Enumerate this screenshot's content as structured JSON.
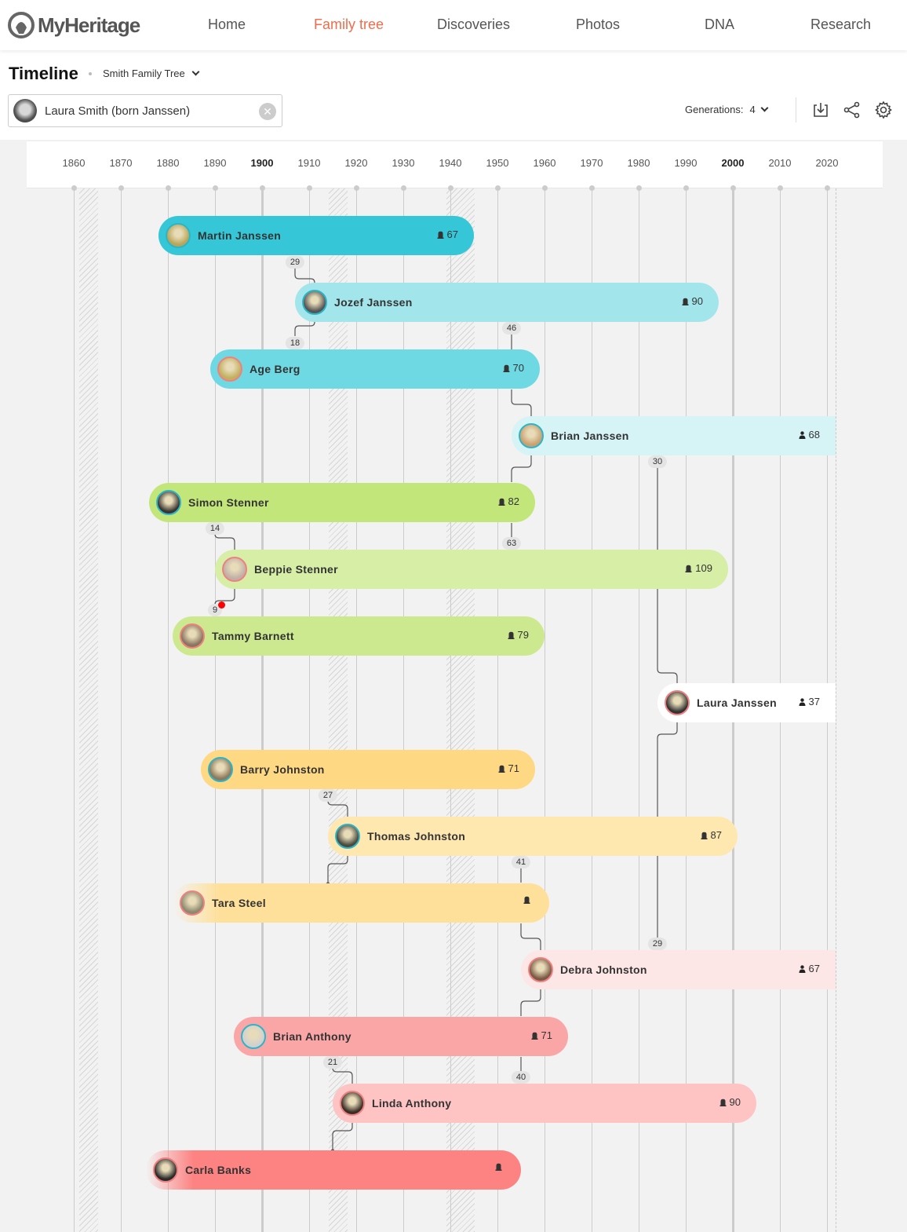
{
  "app": {
    "brand": "MyHeritage",
    "nav": [
      {
        "label": "Home",
        "active": false
      },
      {
        "label": "Family tree",
        "active": true
      },
      {
        "label": "Discoveries",
        "active": false
      },
      {
        "label": "Photos",
        "active": false
      },
      {
        "label": "DNA",
        "active": false
      },
      {
        "label": "Research",
        "active": false
      }
    ],
    "accent_color": "#f26b4a"
  },
  "header": {
    "title": "Timeline",
    "tree_name": "Smith Family Tree",
    "person_search": {
      "value": "Laura Smith (born Janssen)",
      "clear_icon": "close-icon"
    },
    "generations_label": "Generations:",
    "generations_value": "4",
    "tools": [
      "download-icon",
      "share-icon",
      "gear-icon"
    ]
  },
  "timeline": {
    "axis_years": [
      1860,
      1870,
      1880,
      1890,
      1900,
      1910,
      1920,
      1930,
      1940,
      1950,
      1960,
      1970,
      1980,
      1990,
      2000,
      2010,
      2020
    ],
    "major_years": [
      1900,
      2000
    ],
    "shaded_periods": [
      [
        1861,
        1865
      ],
      [
        1914,
        1918
      ],
      [
        1939,
        1945
      ]
    ],
    "people": [
      {
        "name": "Martin Janssen",
        "birth": 1878,
        "death": 1945,
        "age": "67",
        "deceased": true,
        "gender": "m",
        "color": "#35c7d7"
      },
      {
        "name": "Jozef Janssen",
        "birth": 1907,
        "death": 1997,
        "age": "90",
        "deceased": true,
        "gender": "m",
        "color": "#a2e6ec"
      },
      {
        "name": "Age Berg",
        "birth": 1889,
        "death": 1959,
        "age": "70",
        "deceased": true,
        "gender": "f",
        "color": "#6fd9e3"
      },
      {
        "name": "Brian Janssen",
        "birth": 1953,
        "death": null,
        "age": "68",
        "deceased": false,
        "gender": "m",
        "color": "#d6f3f6"
      },
      {
        "name": "Simon Stenner",
        "birth": 1876,
        "death": 1958,
        "age": "82",
        "deceased": true,
        "gender": "m",
        "color": "#c2e67a"
      },
      {
        "name": "Beppie Stenner",
        "birth": 1890,
        "death": 1999,
        "age": "109",
        "deceased": true,
        "gender": "f",
        "color": "#d6eea6"
      },
      {
        "name": "Tammy Barnett",
        "birth": 1881,
        "death": 1960,
        "age": "79",
        "deceased": true,
        "gender": "f",
        "color": "#cce98f"
      },
      {
        "name": "Laura Janssen",
        "birth": 1984,
        "death": null,
        "age": "37",
        "deceased": false,
        "gender": "f",
        "color": "#ffffff"
      },
      {
        "name": "Barry Johnston",
        "birth": 1887,
        "death": 1958,
        "age": "71",
        "deceased": true,
        "gender": "m",
        "color": "#ffd883"
      },
      {
        "name": "Thomas Johnston",
        "birth": 1914,
        "death": 2001,
        "age": "87",
        "deceased": true,
        "gender": "m",
        "color": "#ffe8b0"
      },
      {
        "name": "Tara Steel",
        "birth": null,
        "death": 1961,
        "age": "",
        "deceased": true,
        "gender": "f",
        "color": "#ffe09a"
      },
      {
        "name": "Debra Johnston",
        "birth": 1955,
        "death": null,
        "age": "67",
        "deceased": false,
        "gender": "f",
        "color": "#fde6e6"
      },
      {
        "name": "Brian Anthony",
        "birth": 1894,
        "death": 1965,
        "age": "71",
        "deceased": true,
        "gender": "m",
        "color": "#fba6a6"
      },
      {
        "name": "Linda Anthony",
        "birth": 1915,
        "death": 2005,
        "age": "90",
        "deceased": true,
        "gender": "f",
        "color": "#fec4c4"
      },
      {
        "name": "Carla Banks",
        "birth": null,
        "death": 1955,
        "age": "",
        "deceased": true,
        "gender": "f",
        "color": "#fd8383"
      }
    ],
    "parent_age_badges": [
      "29",
      "18",
      "46",
      "30",
      "14",
      "63",
      "9",
      "27",
      "41",
      "29",
      "21",
      "40"
    ]
  }
}
